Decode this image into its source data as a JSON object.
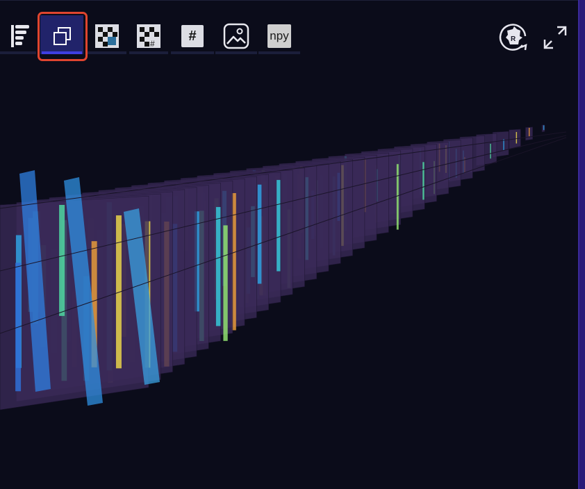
{
  "toolbar": {
    "buttons": [
      {
        "name": "layers-list-button",
        "icon": "list-bars-icon"
      },
      {
        "name": "volume-3d-view-button",
        "icon": "stacked-squares-icon",
        "active": true
      },
      {
        "name": "checker-view-button",
        "icon": "checkerboard-icon"
      },
      {
        "name": "checker-grid-view-button",
        "icon": "checkerboard-hash-icon",
        "label": "#"
      },
      {
        "name": "grid-number-view-button",
        "icon": "hash-icon",
        "label": "#"
      },
      {
        "name": "image-view-button",
        "icon": "image-icon"
      },
      {
        "name": "npy-export-button",
        "icon": "npy-icon",
        "label": "npy"
      }
    ]
  },
  "controls": {
    "reset_icon": "reset-rotation-icon",
    "reset_badge": "R",
    "fullscreen_icon": "expand-arrows-icon"
  },
  "colors": {
    "background": "#0b0c1a",
    "active_accent": "#3f3fe0",
    "highlight": "#e0452f",
    "sidebar": "#2a1a78",
    "cube_base": "#3d2a5a"
  }
}
